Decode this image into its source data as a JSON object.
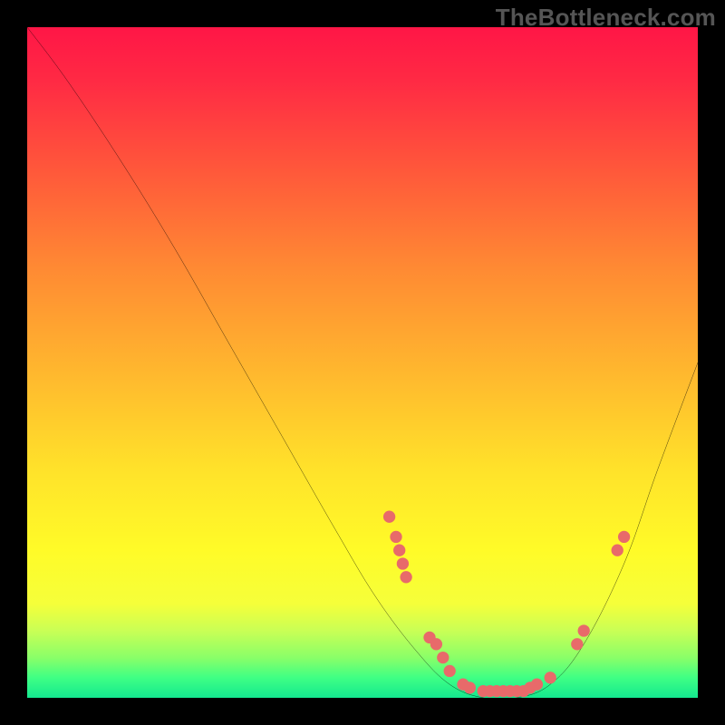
{
  "watermark": "TheBottleneck.com",
  "chart_data": {
    "type": "line",
    "title": "",
    "xlabel": "",
    "ylabel": "",
    "xlim": [
      0,
      100
    ],
    "ylim": [
      0,
      100
    ],
    "curve": [
      {
        "x": 0,
        "y": 100
      },
      {
        "x": 6,
        "y": 92
      },
      {
        "x": 14,
        "y": 80
      },
      {
        "x": 22,
        "y": 67
      },
      {
        "x": 30,
        "y": 53
      },
      {
        "x": 38,
        "y": 39
      },
      {
        "x": 46,
        "y": 25
      },
      {
        "x": 52,
        "y": 15
      },
      {
        "x": 58,
        "y": 7
      },
      {
        "x": 63,
        "y": 2
      },
      {
        "x": 68,
        "y": 0
      },
      {
        "x": 73,
        "y": 0
      },
      {
        "x": 78,
        "y": 2
      },
      {
        "x": 83,
        "y": 8
      },
      {
        "x": 89,
        "y": 20
      },
      {
        "x": 94,
        "y": 34
      },
      {
        "x": 100,
        "y": 50
      }
    ],
    "markers": [
      {
        "x": 54,
        "y": 27
      },
      {
        "x": 55,
        "y": 24
      },
      {
        "x": 55.5,
        "y": 22
      },
      {
        "x": 56,
        "y": 20
      },
      {
        "x": 56.5,
        "y": 18
      },
      {
        "x": 60,
        "y": 9
      },
      {
        "x": 61,
        "y": 8
      },
      {
        "x": 62,
        "y": 6
      },
      {
        "x": 63,
        "y": 4
      },
      {
        "x": 65,
        "y": 2
      },
      {
        "x": 66,
        "y": 1.5
      },
      {
        "x": 68,
        "y": 1
      },
      {
        "x": 69,
        "y": 1
      },
      {
        "x": 70,
        "y": 1
      },
      {
        "x": 71,
        "y": 1
      },
      {
        "x": 72,
        "y": 1
      },
      {
        "x": 73,
        "y": 1
      },
      {
        "x": 74,
        "y": 1
      },
      {
        "x": 75,
        "y": 1.5
      },
      {
        "x": 76,
        "y": 2
      },
      {
        "x": 78,
        "y": 3
      },
      {
        "x": 82,
        "y": 8
      },
      {
        "x": 83,
        "y": 10
      },
      {
        "x": 88,
        "y": 22
      },
      {
        "x": 89,
        "y": 24
      }
    ]
  }
}
